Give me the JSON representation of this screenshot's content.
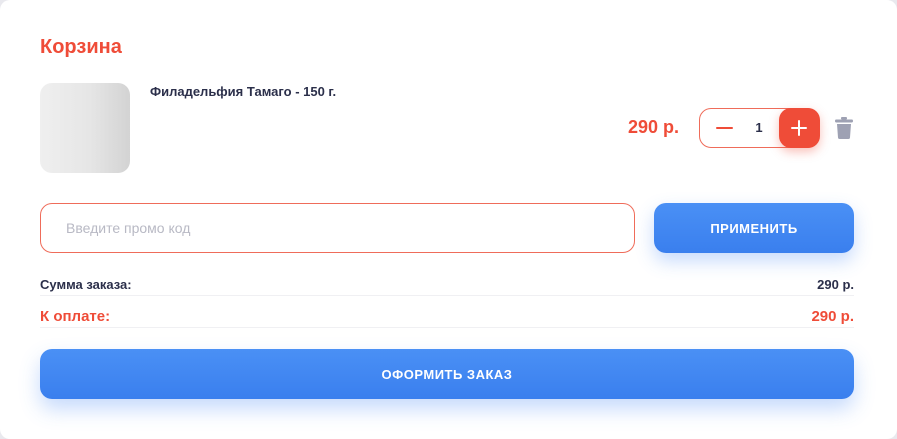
{
  "cart": {
    "title": "Корзина",
    "items": [
      {
        "name": "Филадельфия Тамаго - 150 г.",
        "price": "290 р.",
        "quantity": "1"
      }
    ],
    "promo": {
      "placeholder": "Введите промо код",
      "apply_label": "ПРИМЕНИТЬ"
    },
    "summary": {
      "order_sum_label": "Сумма заказа:",
      "order_sum_value": "290 р.",
      "to_pay_label": "К оплате:",
      "to_pay_value": "290 р."
    },
    "checkout_label": "ОФОРМИТЬ ЗАКАЗ"
  },
  "colors": {
    "accent": "#ef4c38",
    "primary": "#3a7fee",
    "text": "#2b2f4a"
  },
  "icons": [
    "minus-icon",
    "plus-icon",
    "trash-icon"
  ]
}
